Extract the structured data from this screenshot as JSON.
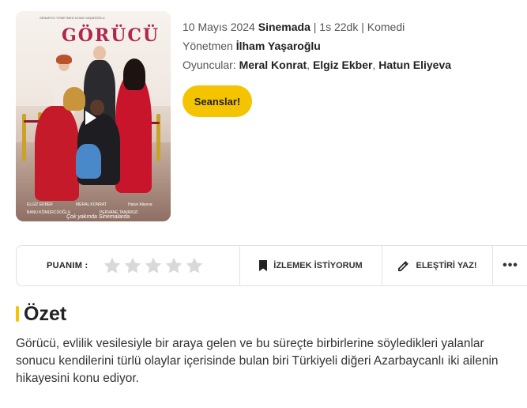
{
  "poster": {
    "title_art": "GÖRÜCÜ",
    "credits_top": "SENARYO-YÖNETMEN İLHAM YAŞAROĞLU",
    "names": {
      "elgiz": "ELGİZ EKBER",
      "meral": "MERAL KONRAT",
      "hatun": "Hatun Aliyeva",
      "banu": "BANU KÖMÜRCÜOĞLU",
      "pervane": "PERVANE TANIRKIZI"
    },
    "signature": "Çok yakında Sinemalarda"
  },
  "movie": {
    "release_date": "10 Mayıs 2024",
    "status": "Sinemada",
    "separator": "|",
    "duration": "1s 22dk",
    "genre": "Komedi",
    "director_label": "Yönetmen",
    "director": "İlham Yaşaroğlu",
    "cast_label": "Oyuncular:",
    "cast": [
      "Meral Konrat",
      "Elgiz Ekber",
      "Hatun Eliyeva"
    ],
    "comma": ","
  },
  "buttons": {
    "seanslar": "Seanslar!",
    "watchlist": "İZLEMEK İSTİYORUM",
    "review": "ELEŞTİRİ YAZ!",
    "more": "•••"
  },
  "rating": {
    "label": "PUANIM :",
    "value": 0,
    "max": 5,
    "empty_color": "#d9d9d9"
  },
  "summary": {
    "title": "Özet",
    "text": "Görücü, evlilik vesilesiyle bir araya gelen ve bu süreçte birbirlerine söyledikleri yalanlar sonucu kendilerini türlü olaylar içerisinde bulan biri Türkiyeli diğeri Azarbaycanlı iki ailenin hikayesini konu ediyor."
  },
  "colors": {
    "accent": "#f5c400",
    "title_art": "#b1264c"
  },
  "icons": {
    "play": "play-icon",
    "bookmark": "bookmark-icon",
    "pencil": "pencil-icon",
    "star": "star-icon",
    "more": "more-icon"
  }
}
